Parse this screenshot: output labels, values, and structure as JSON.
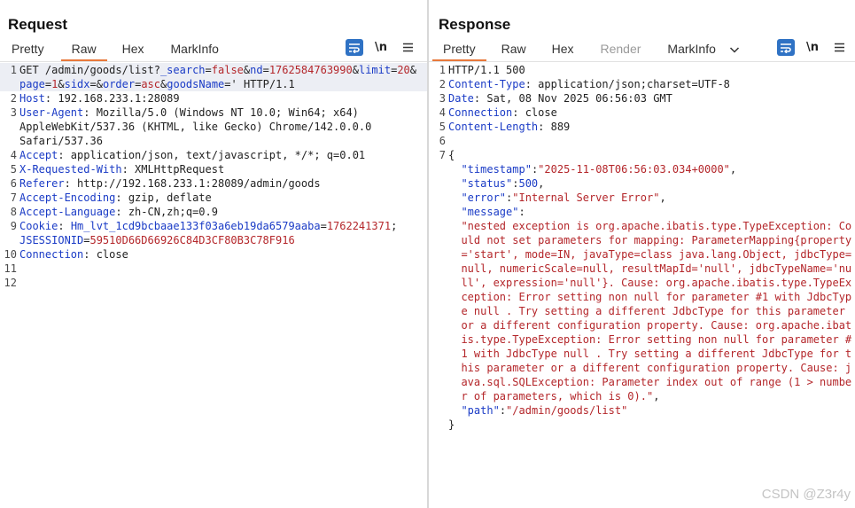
{
  "view_layout": {
    "options": [
      "split-horizontal",
      "split-vertical",
      "single"
    ],
    "selected": "split-horizontal"
  },
  "request": {
    "title": "Request",
    "tabs": [
      "Pretty",
      "Raw",
      "Hex",
      "MarkInfo"
    ],
    "active_tab": "Raw",
    "newline_toggle": "\\n",
    "lines": [
      {
        "n": "1",
        "segs": [
          [
            "GET /admin/goods/list?",
            "p"
          ],
          [
            "_search",
            "k"
          ],
          [
            "=",
            "p"
          ],
          [
            "false",
            "v"
          ],
          [
            "&",
            "p"
          ],
          [
            "nd",
            "k"
          ],
          [
            "=",
            "p"
          ],
          [
            "1762584763990",
            "v"
          ],
          [
            "&",
            "p"
          ],
          [
            "limit",
            "k"
          ],
          [
            "=",
            "p"
          ],
          [
            "20",
            "v"
          ],
          [
            "&",
            "p"
          ]
        ]
      },
      {
        "n": "",
        "segs": [
          [
            "page",
            "k"
          ],
          [
            "=",
            "p"
          ],
          [
            "1",
            "v"
          ],
          [
            "&",
            "p"
          ],
          [
            "sidx",
            "k"
          ],
          [
            "=&",
            "p"
          ],
          [
            "order",
            "k"
          ],
          [
            "=",
            "p"
          ],
          [
            "asc",
            "v"
          ],
          [
            "&",
            "p"
          ],
          [
            "goodsName",
            "k"
          ],
          [
            "=' HTTP/1.1",
            "p"
          ]
        ]
      },
      {
        "n": "2",
        "segs": [
          [
            "Host",
            "k"
          ],
          [
            ": 192.168.233.1:28089",
            "p"
          ]
        ]
      },
      {
        "n": "3",
        "segs": [
          [
            "User-Agent",
            "k"
          ],
          [
            ": Mozilla/5.0 (Windows NT 10.0; Win64; x64)",
            "p"
          ]
        ]
      },
      {
        "n": "",
        "segs": [
          [
            "AppleWebKit/537.36 (KHTML, like Gecko) Chrome/142.0.0.0",
            "p"
          ]
        ]
      },
      {
        "n": "",
        "segs": [
          [
            "Safari/537.36",
            "p"
          ]
        ]
      },
      {
        "n": "4",
        "segs": [
          [
            "Accept",
            "k"
          ],
          [
            ": application/json, text/javascript, */*; q=0.01",
            "p"
          ]
        ]
      },
      {
        "n": "5",
        "segs": [
          [
            "X-Requested-With",
            "k"
          ],
          [
            ": XMLHttpRequest",
            "p"
          ]
        ]
      },
      {
        "n": "6",
        "segs": [
          [
            "Referer",
            "k"
          ],
          [
            ": http://192.168.233.1:28089/admin/goods",
            "p"
          ]
        ]
      },
      {
        "n": "7",
        "segs": [
          [
            "Accept-Encoding",
            "k"
          ],
          [
            ": gzip, deflate",
            "p"
          ]
        ]
      },
      {
        "n": "8",
        "segs": [
          [
            "Accept-Language",
            "k"
          ],
          [
            ": zh-CN,zh;q=0.9",
            "p"
          ]
        ]
      },
      {
        "n": "9",
        "segs": [
          [
            "Cookie",
            "k"
          ],
          [
            ": ",
            "p"
          ],
          [
            "Hm_lvt_1cd9bcbaae133f03a6eb19da6579aaba",
            "k"
          ],
          [
            "=",
            "p"
          ],
          [
            "1762241371",
            "v"
          ],
          [
            ";",
            "p"
          ]
        ]
      },
      {
        "n": "",
        "segs": [
          [
            "JSESSIONID",
            "k"
          ],
          [
            "=",
            "p"
          ],
          [
            "59510D66D66926C84D3CF80B3C78F916",
            "v"
          ]
        ]
      },
      {
        "n": "10",
        "segs": [
          [
            "Connection",
            "k"
          ],
          [
            ": close",
            "p"
          ]
        ]
      },
      {
        "n": "11",
        "segs": []
      },
      {
        "n": "12",
        "segs": []
      }
    ]
  },
  "response": {
    "title": "Response",
    "tabs": [
      "Pretty",
      "Raw",
      "Hex",
      "Render",
      "MarkInfo"
    ],
    "active_tab": "Pretty",
    "disabled_tab": "Render",
    "newline_toggle": "\\n",
    "lines": [
      {
        "n": "1",
        "segs": [
          [
            "HTTP/1.1 500",
            "p"
          ]
        ]
      },
      {
        "n": "2",
        "segs": [
          [
            "Content-Type",
            "k"
          ],
          [
            ": application/json;charset=UTF-8",
            "p"
          ]
        ]
      },
      {
        "n": "3",
        "segs": [
          [
            "Date",
            "k"
          ],
          [
            ": Sat, 08 Nov 2025 06:56:03 GMT",
            "p"
          ]
        ]
      },
      {
        "n": "4",
        "segs": [
          [
            "Connection",
            "k"
          ],
          [
            ": close",
            "p"
          ]
        ]
      },
      {
        "n": "5",
        "segs": [
          [
            "Content-Length",
            "k"
          ],
          [
            ": 889",
            "p"
          ]
        ]
      },
      {
        "n": "6",
        "segs": []
      },
      {
        "n": "7",
        "segs": [
          [
            "{",
            "p"
          ]
        ]
      },
      {
        "n": "",
        "segs": [
          [
            "  ",
            "p"
          ],
          [
            "\"timestamp\"",
            "k"
          ],
          [
            ":",
            "p"
          ],
          [
            "\"2025-11-08T06:56:03.034+0000\"",
            "v"
          ],
          [
            ",",
            "p"
          ]
        ]
      },
      {
        "n": "",
        "segs": [
          [
            "  ",
            "p"
          ],
          [
            "\"status\"",
            "k"
          ],
          [
            ":",
            "p"
          ],
          [
            "500",
            "k"
          ],
          [
            ",",
            "p"
          ]
        ]
      },
      {
        "n": "",
        "segs": [
          [
            "  ",
            "p"
          ],
          [
            "\"error\"",
            "k"
          ],
          [
            ":",
            "p"
          ],
          [
            "\"Internal Server Error\"",
            "v"
          ],
          [
            ",",
            "p"
          ]
        ]
      },
      {
        "n": "",
        "segs": [
          [
            "  ",
            "p"
          ],
          [
            "\"message\"",
            "k"
          ],
          [
            ":",
            "p"
          ]
        ]
      },
      {
        "n": "",
        "segs": [
          [
            "  ",
            "p"
          ],
          [
            "\"nested exception is org.apache.ibatis.type.TypeException: Co",
            "v"
          ]
        ]
      },
      {
        "n": "",
        "segs": [
          [
            "  ",
            "p"
          ],
          [
            "uld not set parameters for mapping: ParameterMapping{property",
            "v"
          ]
        ]
      },
      {
        "n": "",
        "segs": [
          [
            "  ",
            "p"
          ],
          [
            "='start', mode=IN, javaType=class java.lang.Object, jdbcType=",
            "v"
          ]
        ]
      },
      {
        "n": "",
        "segs": [
          [
            "  ",
            "p"
          ],
          [
            "null, numericScale=null, resultMapId='null', jdbcTypeName='nu",
            "v"
          ]
        ]
      },
      {
        "n": "",
        "segs": [
          [
            "  ",
            "p"
          ],
          [
            "ll', expression='null'}. Cause: org.apache.ibatis.type.TypeEx",
            "v"
          ]
        ]
      },
      {
        "n": "",
        "segs": [
          [
            "  ",
            "p"
          ],
          [
            "ception: Error setting non null for parameter #1 with JdbcTyp",
            "v"
          ]
        ]
      },
      {
        "n": "",
        "segs": [
          [
            "  ",
            "p"
          ],
          [
            "e null . Try setting a different JdbcType for this parameter",
            "v"
          ]
        ]
      },
      {
        "n": "",
        "segs": [
          [
            "  ",
            "p"
          ],
          [
            "or a different configuration property. Cause: org.apache.ibat",
            "v"
          ]
        ]
      },
      {
        "n": "",
        "segs": [
          [
            "  ",
            "p"
          ],
          [
            "is.type.TypeException: Error setting non null for parameter #",
            "v"
          ]
        ]
      },
      {
        "n": "",
        "segs": [
          [
            "  ",
            "p"
          ],
          [
            "1 with JdbcType null . Try setting a different JdbcType for t",
            "v"
          ]
        ]
      },
      {
        "n": "",
        "segs": [
          [
            "  ",
            "p"
          ],
          [
            "his parameter or a different configuration property. Cause: j",
            "v"
          ]
        ]
      },
      {
        "n": "",
        "segs": [
          [
            "  ",
            "p"
          ],
          [
            "ava.sql.SQLException: Parameter index out of range (1 > numbe",
            "v"
          ]
        ]
      },
      {
        "n": "",
        "segs": [
          [
            "  ",
            "p"
          ],
          [
            "r of parameters, which is 0).\"",
            "v"
          ],
          [
            ",",
            "p"
          ]
        ]
      },
      {
        "n": "",
        "segs": [
          [
            "  ",
            "p"
          ],
          [
            "\"path\"",
            "k"
          ],
          [
            ":",
            "p"
          ],
          [
            "\"/admin/goods/list\"",
            "v"
          ]
        ]
      },
      {
        "n": "",
        "segs": [
          [
            "}",
            "p"
          ]
        ]
      }
    ]
  },
  "watermark": "CSDN @Z3r4y"
}
